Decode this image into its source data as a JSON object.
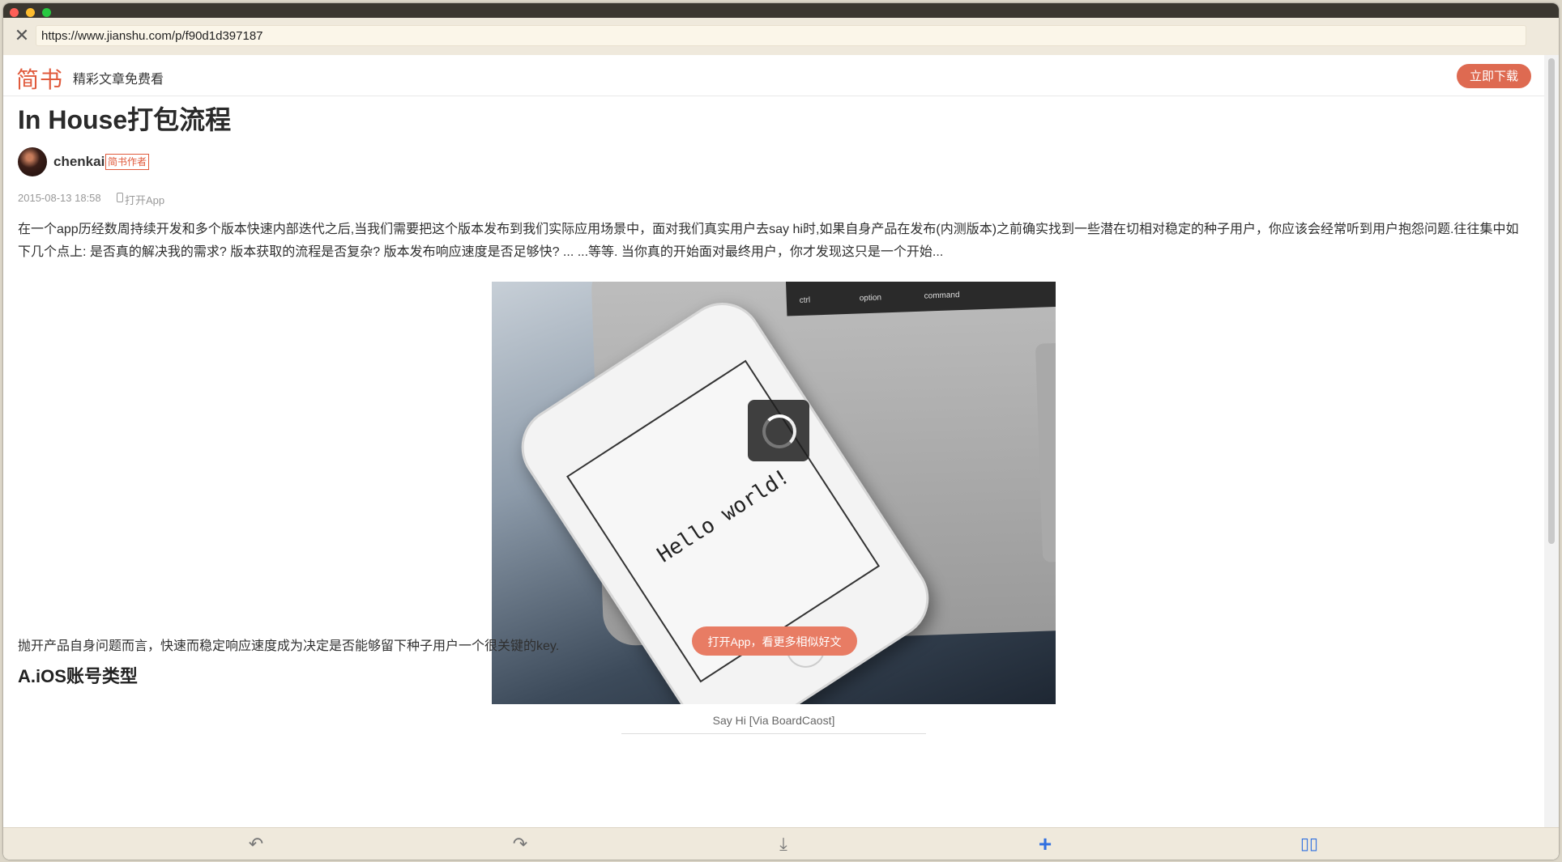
{
  "browser": {
    "url": "https://www.jianshu.com/p/f90d1d397187",
    "close_glyph": "✕"
  },
  "site": {
    "logo": "简书",
    "tagline": "精彩文章免费看",
    "download_label": "立即下载"
  },
  "article": {
    "title": "In House打包流程",
    "author": "chenkai",
    "author_badge": "简书作者",
    "date": "2015-08-13 18:58",
    "open_app_link": "打开App",
    "intro": "在一个app历经数周持续开发和多个版本快速内部迭代之后,当我们需要把这个版本发布到我们实际应用场景中，面对我们真实用户去say hi时,如果自身产品在发布(内测版本)之前确实找到一些潜在切相对稳定的种子用户，你应该会经常听到用户抱怨问题.往往集中如下几个点上: 是否真的解决我的需求? 版本获取的流程是否复杂? 版本发布响应速度是否足够快? ... ...等等. 当你真的开始面对最终用户，你才发现这只是一个开始...",
    "image_caption": "Say Hi [Via BoardCaost]",
    "image_hello_text": "Hello world!",
    "keyboard_labels": [
      "option",
      "command",
      "ctrl"
    ],
    "paragraph2": "抛开产品自身问题而言，快速而稳定响应速度成为决定是否能够留下种子用户一个很关键的key.",
    "open_app_button": "打开App，看更多相似好文",
    "subheading": "A.iOS账号类型"
  },
  "toolbar": {
    "undo_glyph": "↶",
    "redo_glyph": "↷",
    "download_glyph": "⤓",
    "plus_glyph": "+",
    "book_glyph": "▯▯"
  },
  "colors": {
    "brand": "#e05a3c",
    "download_button": "#de6a51",
    "open_app_button": "#e87c64",
    "toolbar_accent": "#2f6fe0"
  }
}
